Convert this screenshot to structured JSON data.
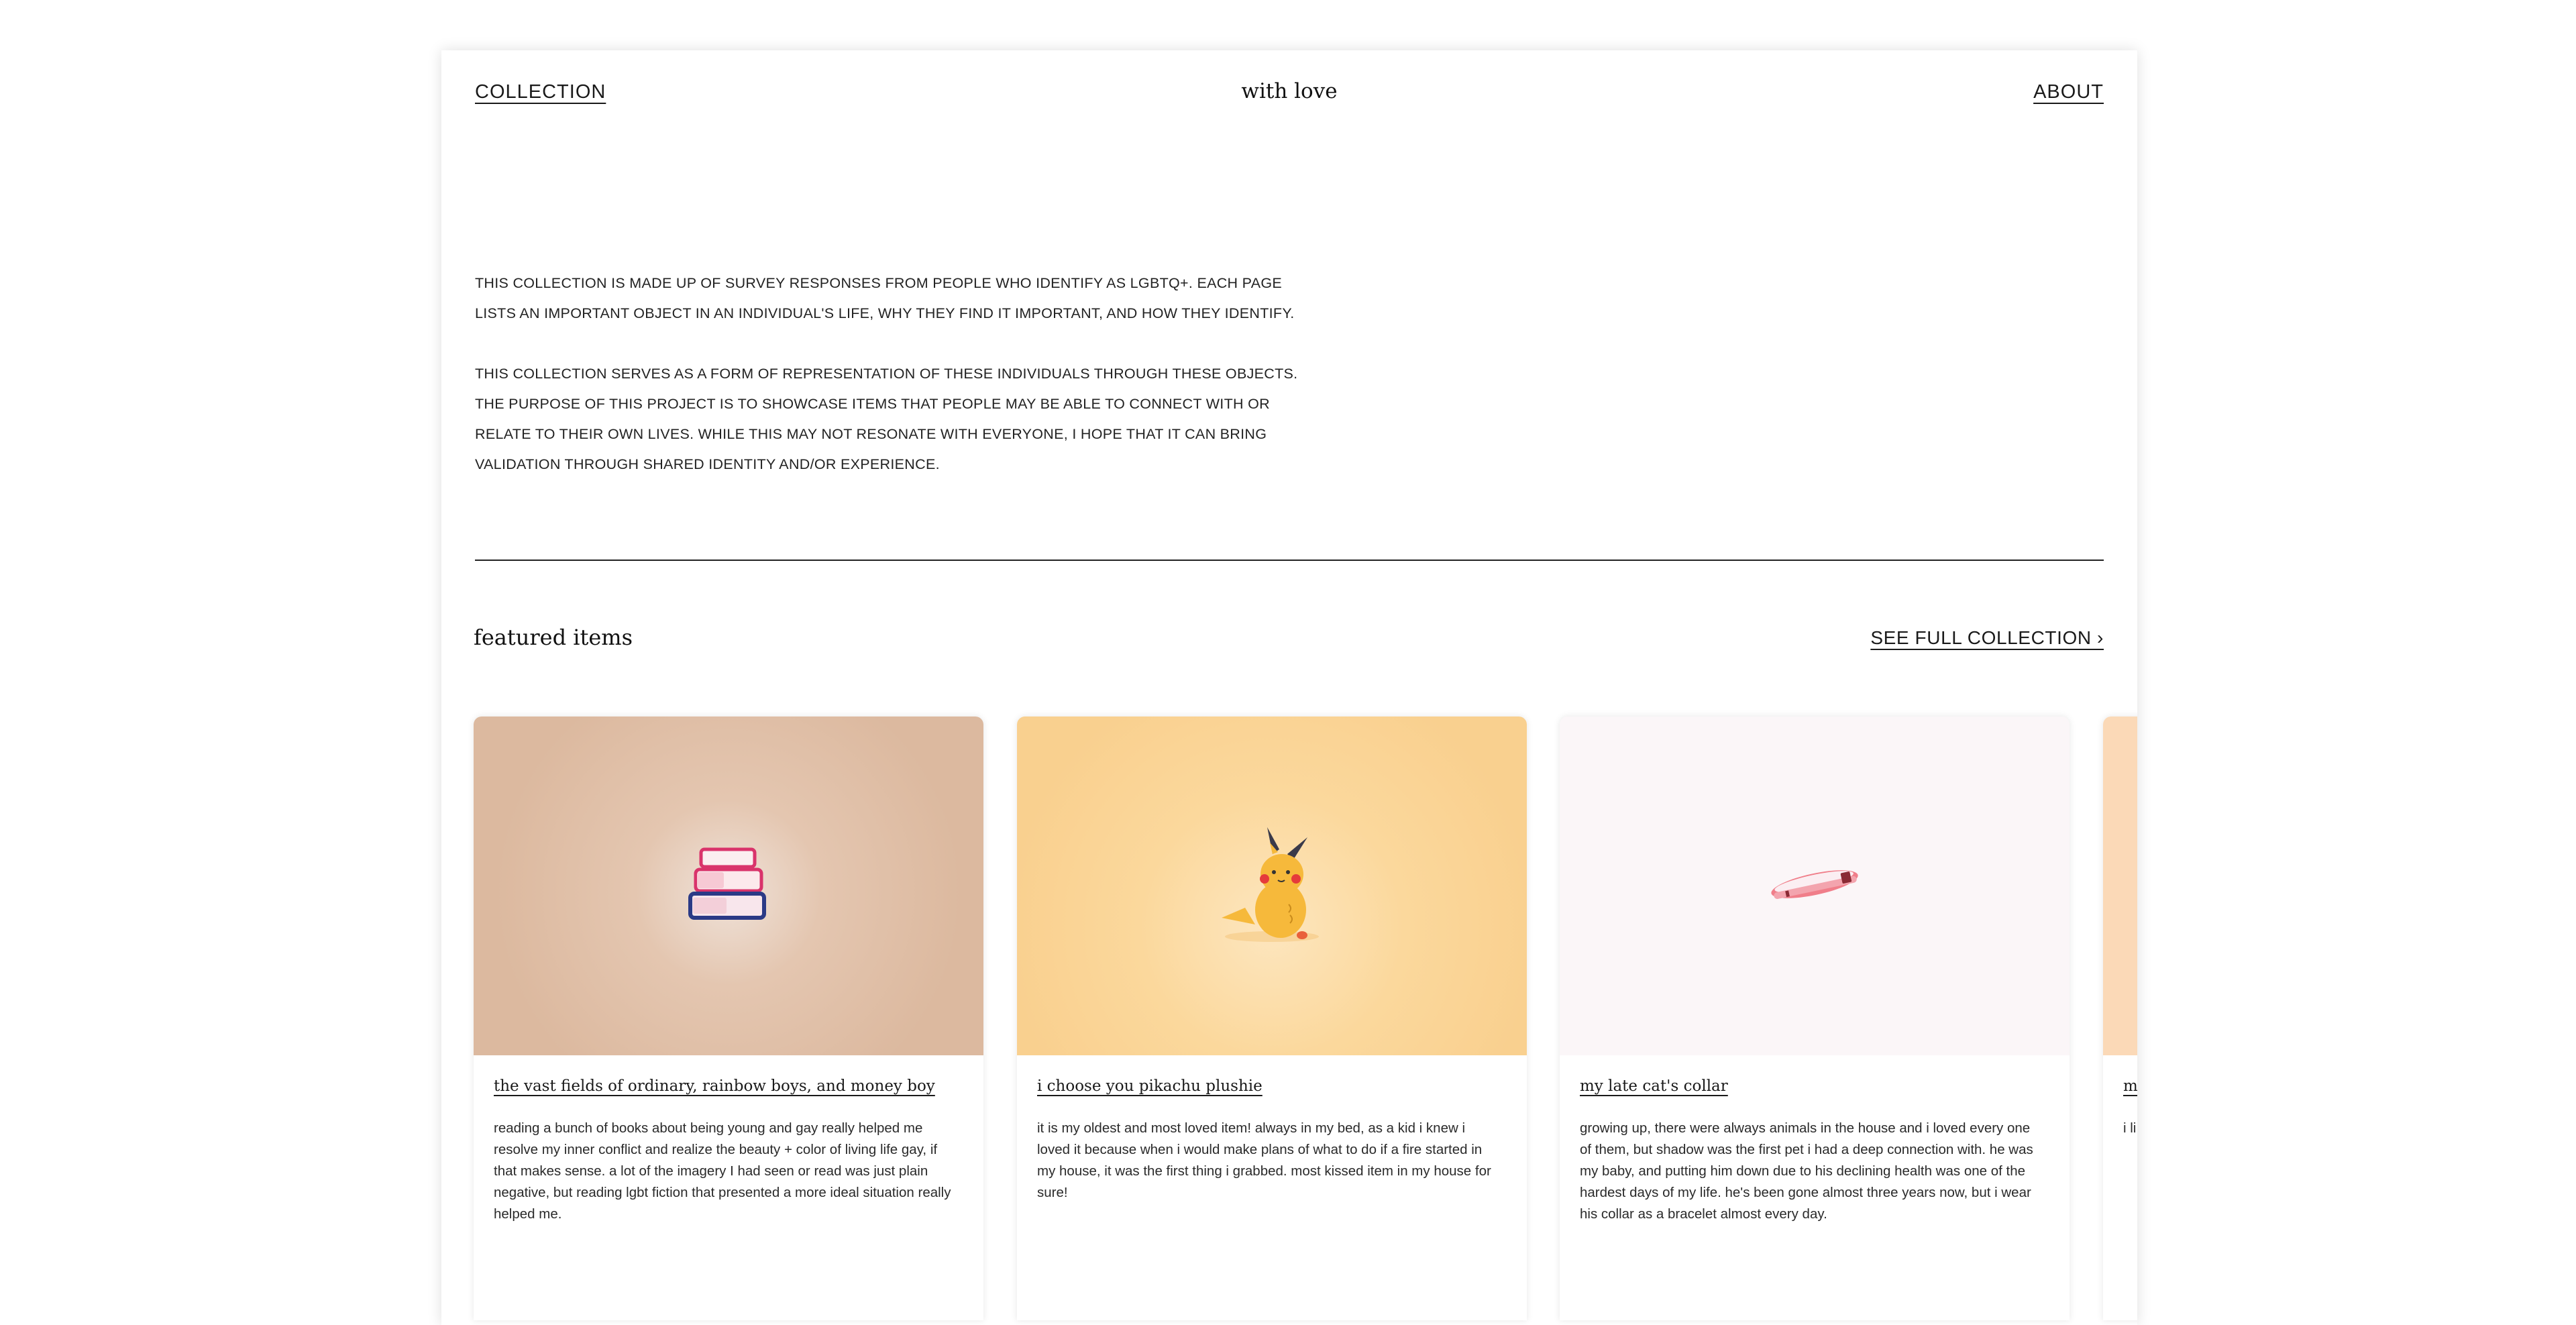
{
  "nav": {
    "collection_label": "COLLECTION",
    "brand": "with love",
    "about_label": "ABOUT"
  },
  "intro": {
    "paragraph_1": "THIS COLLECTION IS MADE UP OF SURVEY RESPONSES FROM PEOPLE WHO IDENTIFY AS LGBTQ+. EACH PAGE LISTS AN IMPORTANT OBJECT IN AN INDIVIDUAL'S LIFE, WHY THEY FIND IT IMPORTANT, AND HOW THEY IDENTIFY.",
    "paragraph_2": "THIS COLLECTION SERVES AS A FORM OF REPRESENTATION OF THESE INDIVIDUALS THROUGH THESE OBJECTS. THE PURPOSE OF THIS PROJECT IS TO SHOWCASE ITEMS THAT PEOPLE MAY BE ABLE TO CONNECT WITH OR RELATE TO THEIR OWN LIVES. WHILE THIS MAY NOT RESONATE WITH EVERYONE, I HOPE THAT IT CAN BRING VALIDATION THROUGH SHARED IDENTITY AND/OR EXPERIENCE."
  },
  "featured": {
    "title": "featured items",
    "see_full_label": "SEE FULL COLLECTION ›",
    "items": [
      {
        "title": "the vast fields of ordinary, rainbow boys, and money boy",
        "description": "reading a bunch of books about being young and gay really helped me resolve my inner conflict and realize the beauty + color of living life gay, if that makes sense. a lot of the imagery I had seen or read was just plain negative, but reading lgbt fiction that presented a more ideal situation really helped me.",
        "icon": "books-icon"
      },
      {
        "title": "i choose you pikachu plushie",
        "description": "it is my oldest and most loved item! always in my bed, as a kid i knew i loved it because when i would make plans of what to do if a fire started in my house, it was the first thing i grabbed. most kissed item in my house for sure!",
        "icon": "pikachu-plushie-icon"
      },
      {
        "title": "my late cat's collar",
        "description": "growing up, there were always animals in the house and i loved every one of them, but shadow was the first pet i had a deep connection with. he was my baby, and putting him down due to his declining health was one of the hardest days of my life. he's been gone almost three years now, but i wear his collar as a bracelet almost every day.",
        "icon": "cat-collar-icon"
      },
      {
        "title": "m",
        "description": "i li i'n yo sp the",
        "icon": "item-icon"
      }
    ]
  }
}
